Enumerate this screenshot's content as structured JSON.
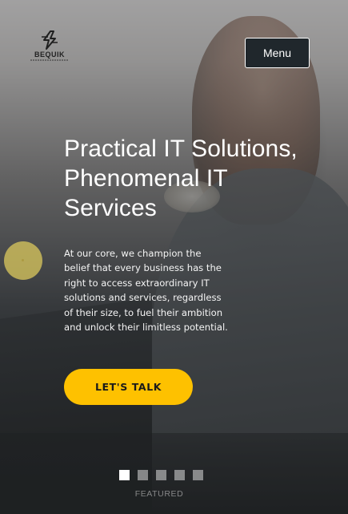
{
  "header": {
    "logo_text": "BEQUIK",
    "menu_label": "Menu"
  },
  "hero": {
    "headline_lines": [
      "Practical IT Solutions,",
      "Phenomenal IT",
      "Services"
    ],
    "paragraph_lines": [
      "At our core, we champion the",
      "belief that every business has the",
      "right to access extraordinary IT",
      "solutions and services, regardless",
      "of their size, to fuel their ambition",
      "and unlock their limitless potential."
    ],
    "cta_label": "LET'S TALK"
  },
  "slider": {
    "dot_count": 5,
    "active_index": 0,
    "caption": "FEATURED"
  },
  "colors": {
    "accent": "#fec100",
    "menu_bg": "#20272c",
    "text": "#ffffff"
  }
}
